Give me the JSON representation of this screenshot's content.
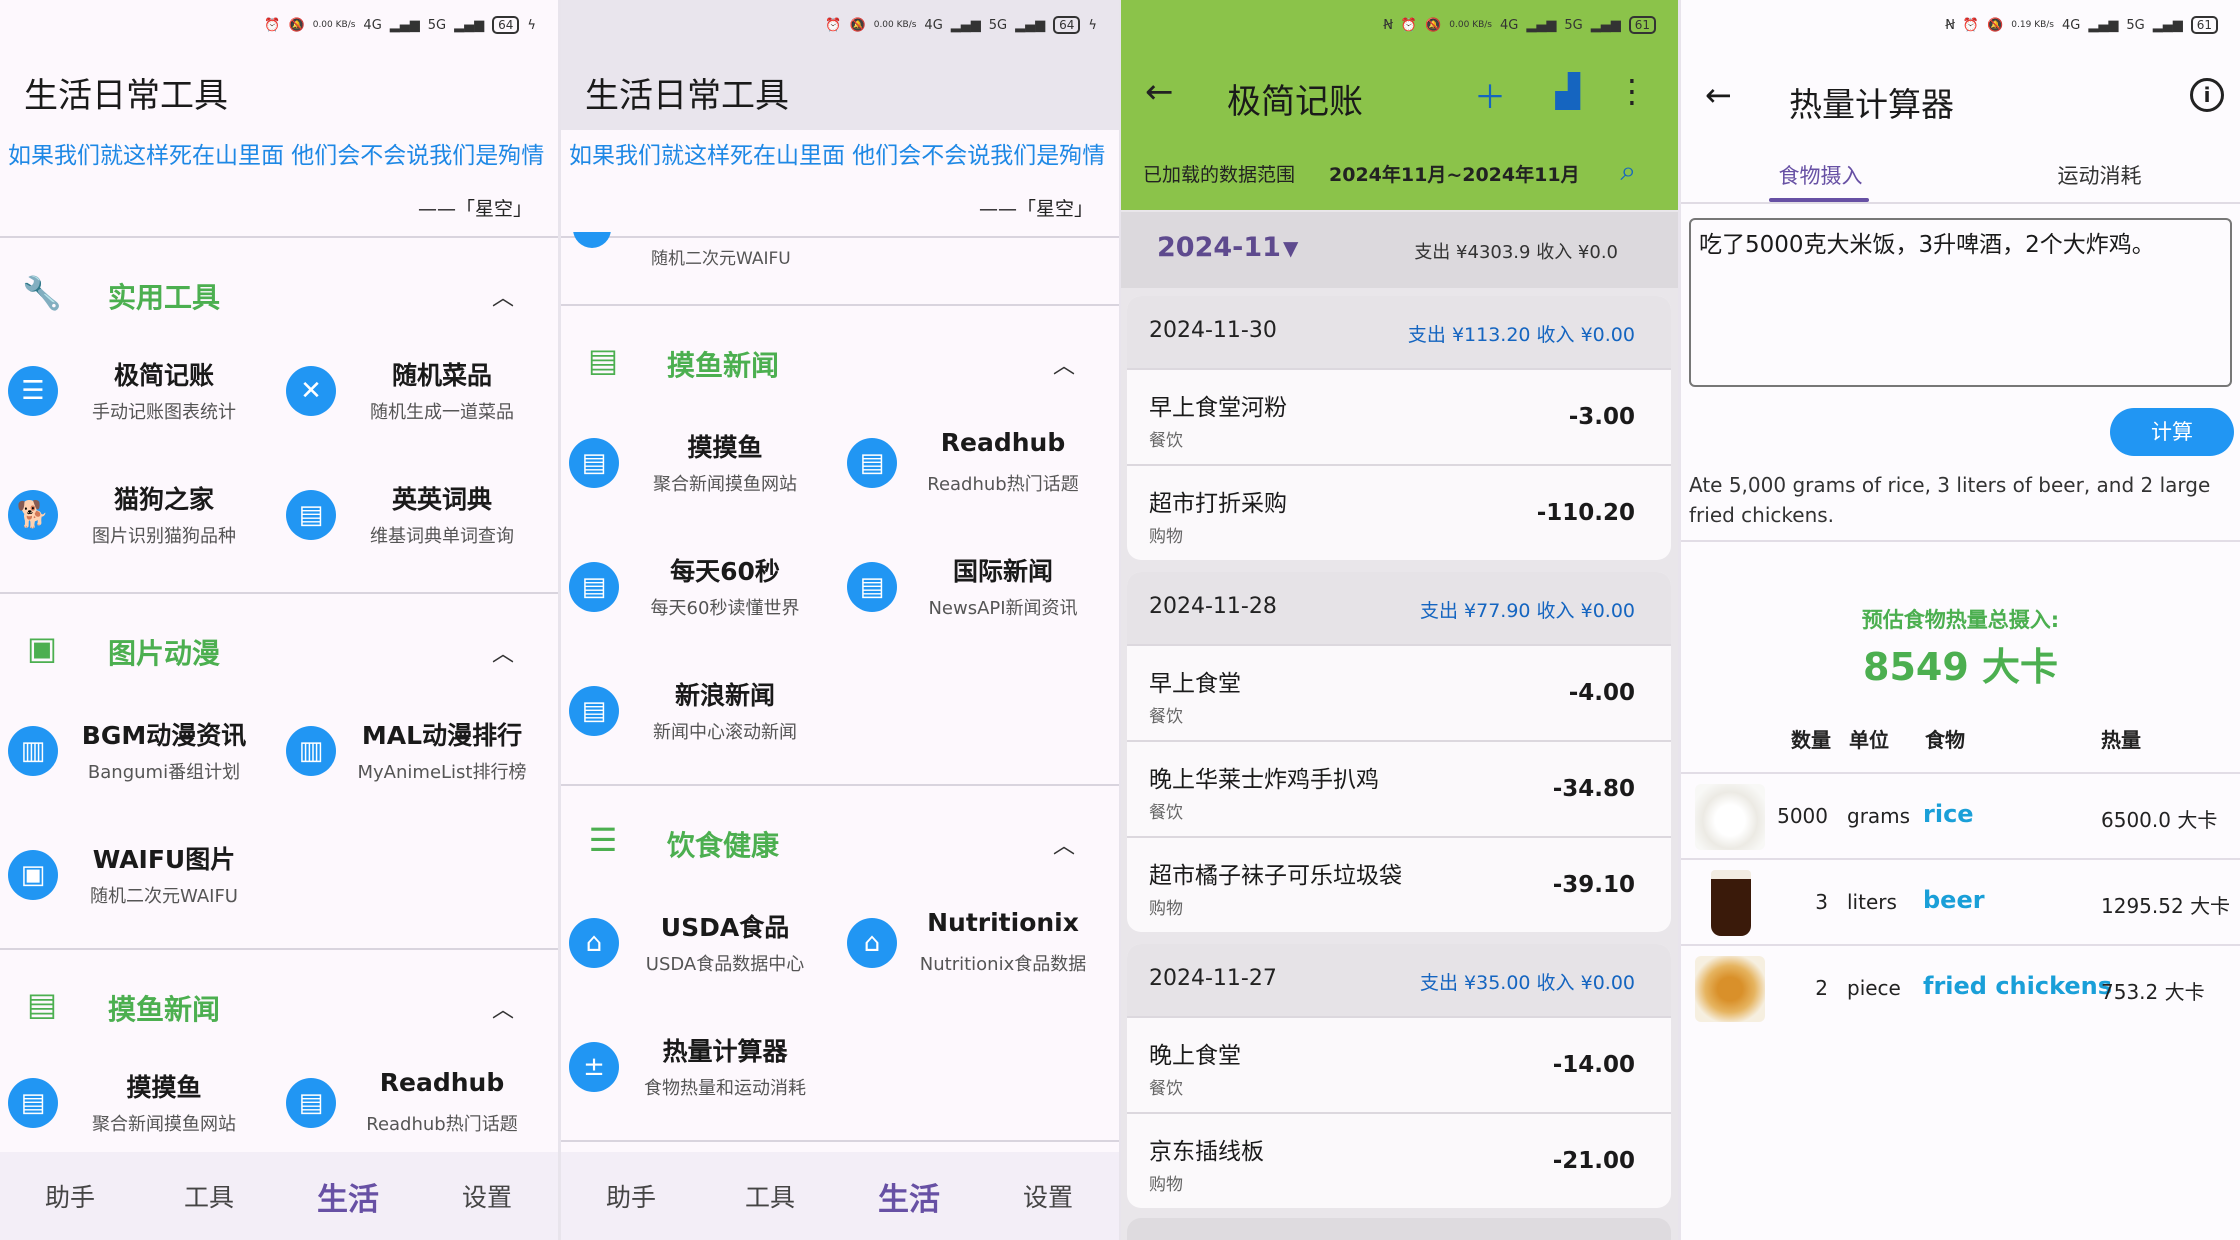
{
  "screen1": {
    "status": {
      "speed": "0.00 KB/s",
      "net1": "4G",
      "net2": "5G",
      "battery": "64"
    },
    "title": "生活日常工具",
    "quote": "如果我们就这样死在山里面 他们会不会说我们是殉情",
    "quote_source": "——「星空」",
    "sections": [
      {
        "title": "实用工具",
        "icon": "wrench-icon",
        "tools": [
          {
            "name": "极简记账",
            "desc": "手动记账图表统计",
            "icon": "ledger-icon"
          },
          {
            "name": "随机菜品",
            "desc": "随机生成一道菜品",
            "icon": "fork-knife-icon"
          },
          {
            "name": "猫狗之家",
            "desc": "图片识别猫狗品种",
            "icon": "dog-icon"
          },
          {
            "name": "英英词典",
            "desc": "维基词典单词查询",
            "icon": "newspaper-icon"
          }
        ]
      },
      {
        "title": "图片动漫",
        "icon": "image-icon",
        "tools": [
          {
            "name": "BGM动漫资讯",
            "desc": "Bangumi番组计划",
            "icon": "bar-chart-icon"
          },
          {
            "name": "MAL动漫排行",
            "desc": "MyAnimeList排行榜",
            "icon": "bar-chart-icon"
          },
          {
            "name": "WAIFU图片",
            "desc": "随机二次元WAIFU",
            "icon": "image-icon"
          }
        ]
      },
      {
        "title": "摸鱼新闻",
        "icon": "newspaper-icon",
        "tools": [
          {
            "name": "摸摸鱼",
            "desc": "聚合新闻摸鱼网站",
            "icon": "newspaper-icon"
          },
          {
            "name": "Readhub",
            "desc": "Readhub热门话题",
            "icon": "newspaper-icon"
          }
        ]
      }
    ],
    "nav": [
      "助手",
      "工具",
      "生活",
      "设置"
    ]
  },
  "screen2": {
    "status": {
      "speed": "0.00 KB/s",
      "net1": "4G",
      "net2": "5G",
      "battery": "64"
    },
    "title": "生活日常工具",
    "quote": "如果我们就这样死在山里面 他们会不会说我们是殉情",
    "quote_source": "——「星空」",
    "cut_text": "随机二次元WAIFU",
    "sections": [
      {
        "title": "摸鱼新闻",
        "icon": "newspaper-icon",
        "tools": [
          {
            "name": "摸摸鱼",
            "desc": "聚合新闻摸鱼网站",
            "icon": "newspaper-icon"
          },
          {
            "name": "Readhub",
            "desc": "Readhub热门话题",
            "icon": "newspaper-icon"
          },
          {
            "name": "每天60秒",
            "desc": "每天60秒读懂世界",
            "icon": "newspaper-icon"
          },
          {
            "name": "国际新闻",
            "desc": "NewsAPI新闻资讯",
            "icon": "newspaper-icon"
          },
          {
            "name": "新浪新闻",
            "desc": "新闻中心滚动新闻",
            "icon": "newspaper-icon"
          }
        ]
      },
      {
        "title": "饮食健康",
        "icon": "food-icon",
        "tools": [
          {
            "name": "USDA食品",
            "desc": "USDA食品数据中心",
            "icon": "restaurant-icon"
          },
          {
            "name": "Nutritionix",
            "desc": "Nutritionix食品数据",
            "icon": "restaurant-icon"
          },
          {
            "name": "热量计算器",
            "desc": "食物热量和运动消耗",
            "icon": "calculator-icon"
          }
        ]
      }
    ],
    "nav": [
      "助手",
      "工具",
      "生活",
      "设置"
    ]
  },
  "screen3": {
    "status": {
      "speed": "0.00 KB/s",
      "net1": "4G",
      "net2": "5G",
      "battery": "61"
    },
    "title": "极简记账",
    "range_label": "已加载的数据范围",
    "range_value": "2024年11月~2024年11月",
    "month": "2024-11",
    "month_summary": "支出 ¥4303.9  收入 ¥0.0",
    "days": [
      {
        "date": "2024-11-30",
        "totals": "支出 ¥113.20 收入 ¥0.00",
        "items": [
          {
            "name": "早上食堂河粉",
            "cat": "餐饮",
            "amount": "-3.00"
          },
          {
            "name": "超市打折采购",
            "cat": "购物",
            "amount": "-110.20"
          }
        ]
      },
      {
        "date": "2024-11-28",
        "totals": "支出 ¥77.90 收入 ¥0.00",
        "items": [
          {
            "name": "早上食堂",
            "cat": "餐饮",
            "amount": "-4.00"
          },
          {
            "name": "晚上华莱士炸鸡手扒鸡",
            "cat": "餐饮",
            "amount": "-34.80"
          },
          {
            "name": "超市橘子袜子可乐垃圾袋",
            "cat": "购物",
            "amount": "-39.10"
          }
        ]
      },
      {
        "date": "2024-11-27",
        "totals": "支出 ¥35.00 收入 ¥0.00",
        "items": [
          {
            "name": "晚上食堂",
            "cat": "餐饮",
            "amount": "-14.00"
          },
          {
            "name": "京东插线板",
            "cat": "购物",
            "amount": "-21.00"
          }
        ]
      }
    ]
  },
  "screen4": {
    "status": {
      "speed": "0.19 KB/s",
      "net1": "4G",
      "net2": "5G",
      "battery": "61"
    },
    "title": "热量计算器",
    "tabs": [
      "食物摄入",
      "运动消耗"
    ],
    "input": "吃了5000克大米饭，3升啤酒，2个大炸鸡。",
    "calc_button": "计算",
    "translation": "Ate 5,000 grams of rice, 3 liters of beer, and 2 large fried chickens.",
    "total_label": "预估食物热量总摄入:",
    "total_value": "8549 大卡",
    "columns": [
      "数量",
      "单位",
      "食物",
      "热量"
    ],
    "foods": [
      {
        "qty": "5000",
        "unit": "grams",
        "food": "rice",
        "kcal": "6500.0 大卡"
      },
      {
        "qty": "3",
        "unit": "liters",
        "food": "beer",
        "kcal": "1295.52 大卡"
      },
      {
        "qty": "2",
        "unit": "piece",
        "food": "fried chickens",
        "kcal": "753.2 大卡"
      }
    ]
  }
}
